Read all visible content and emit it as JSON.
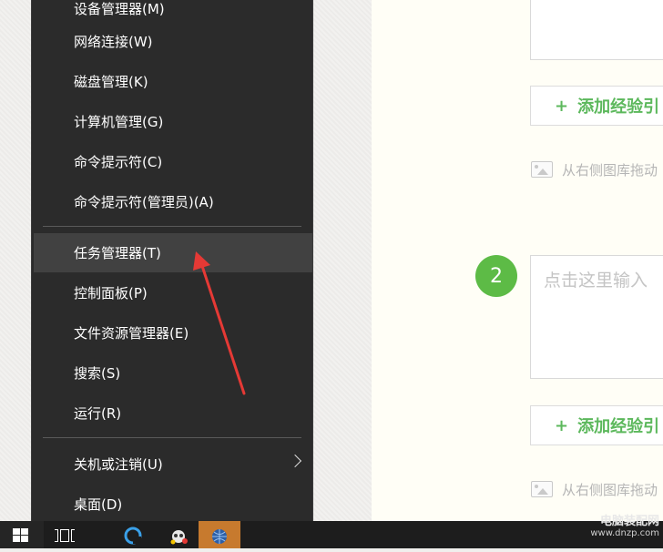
{
  "context_menu": {
    "items": [
      {
        "label": "设备管理器(M)"
      },
      {
        "label": "网络连接(W)"
      },
      {
        "label": "磁盘管理(K)"
      },
      {
        "label": "计算机管理(G)"
      },
      {
        "label": "命令提示符(C)"
      },
      {
        "label": "命令提示符(管理员)(A)"
      },
      {
        "label": "任务管理器(T)"
      },
      {
        "label": "控制面板(P)"
      },
      {
        "label": "文件资源管理器(E)"
      },
      {
        "label": "搜索(S)"
      },
      {
        "label": "运行(R)"
      },
      {
        "label": "关机或注销(U)"
      },
      {
        "label": "桌面(D)"
      }
    ],
    "highlighted_item": "任务管理器(T)"
  },
  "editor": {
    "add_experience_label": "添加经验引",
    "plus_symbol": "+",
    "drag_hint": "从右侧图库拖动",
    "step_number": "2",
    "step_placeholder": "点击这里输入"
  },
  "taskbar": {
    "watermark_text": "电脑装配网",
    "watermark_url": "www.dnzp.com"
  },
  "colors": {
    "menu_bg": "#2b2b2b",
    "menu_highlight": "#414141",
    "accent_green": "#5cb85c",
    "step_badge": "#5dbb46",
    "annotation_red": "#e53935"
  },
  "icons": [
    "windows-logo-icon",
    "task-view-icon",
    "cortana-icon",
    "app-icon",
    "network-app-icon",
    "image-icon",
    "chevron-right-icon"
  ]
}
